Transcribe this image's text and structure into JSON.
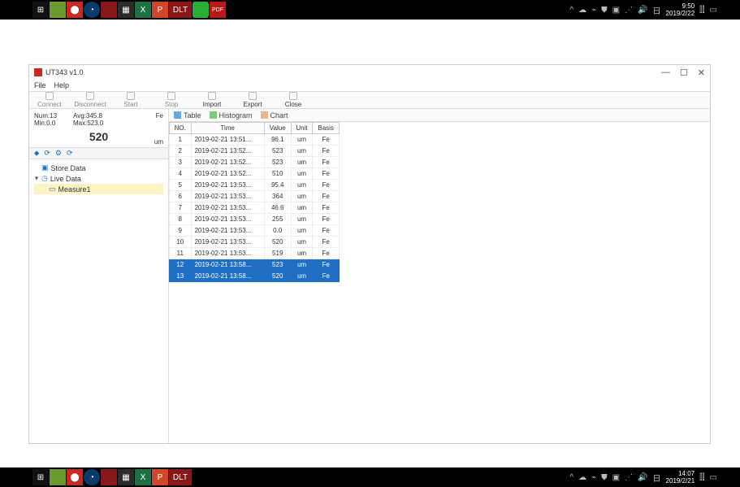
{
  "taskbar_top": {
    "tray": {
      "time": "9:50",
      "date": "2019/2/22"
    }
  },
  "taskbar_bottom": {
    "tray": {
      "time": "14:07",
      "date": "2019/2/21"
    }
  },
  "app": {
    "title": "UT343 v1.0",
    "menu": {
      "file": "File",
      "help": "Help"
    },
    "toolbar": {
      "connect": "Connect",
      "disconnect": "Disconnect",
      "start": "Start",
      "stop": "Stop",
      "import": "Import",
      "export": "Export",
      "close": "Close"
    },
    "stats": {
      "num_label": "Num:13",
      "min_label": "Min:0.0",
      "avg_label": "Avg:345.8",
      "max_label": "Max:523.0",
      "big_value": "520",
      "fe": "Fe",
      "um": "um"
    },
    "tree": {
      "store_data": "Store Data",
      "live_data": "Live Data",
      "measure1": "Measure1"
    },
    "tabs": {
      "table": "Table",
      "histogram": "Histogram",
      "chart": "Chart"
    },
    "table": {
      "headers": {
        "no": "NO.",
        "time": "Time",
        "value": "Value",
        "unit": "Unit",
        "basis": "Basis"
      },
      "rows": [
        {
          "no": "1",
          "time": "2019-02-21 13:51...",
          "value": "96.1",
          "unit": "um",
          "basis": "Fe",
          "selected": false
        },
        {
          "no": "2",
          "time": "2019-02-21 13:52...",
          "value": "523",
          "unit": "um",
          "basis": "Fe",
          "selected": false
        },
        {
          "no": "3",
          "time": "2019-02-21 13:52...",
          "value": "523",
          "unit": "um",
          "basis": "Fe",
          "selected": false
        },
        {
          "no": "4",
          "time": "2019-02-21 13:52...",
          "value": "510",
          "unit": "um",
          "basis": "Fe",
          "selected": false
        },
        {
          "no": "5",
          "time": "2019-02-21 13:53...",
          "value": "95.4",
          "unit": "um",
          "basis": "Fe",
          "selected": false
        },
        {
          "no": "6",
          "time": "2019-02-21 13:53...",
          "value": "364",
          "unit": "um",
          "basis": "Fe",
          "selected": false
        },
        {
          "no": "7",
          "time": "2019-02-21 13:53...",
          "value": "46.6",
          "unit": "um",
          "basis": "Fe",
          "selected": false
        },
        {
          "no": "8",
          "time": "2019-02-21 13:53...",
          "value": "255",
          "unit": "um",
          "basis": "Fe",
          "selected": false
        },
        {
          "no": "9",
          "time": "2019-02-21 13:53...",
          "value": "0.0",
          "unit": "um",
          "basis": "Fe",
          "selected": false
        },
        {
          "no": "10",
          "time": "2019-02-21 13:53...",
          "value": "520",
          "unit": "um",
          "basis": "Fe",
          "selected": false
        },
        {
          "no": "11",
          "time": "2019-02-21 13:53...",
          "value": "519",
          "unit": "um",
          "basis": "Fe",
          "selected": false
        },
        {
          "no": "12",
          "time": "2019-02-21 13:58...",
          "value": "523",
          "unit": "um",
          "basis": "Fe",
          "selected": true
        },
        {
          "no": "13",
          "time": "2019-02-21 13:58...",
          "value": "520",
          "unit": "um",
          "basis": "Fe",
          "selected": true
        }
      ]
    }
  }
}
